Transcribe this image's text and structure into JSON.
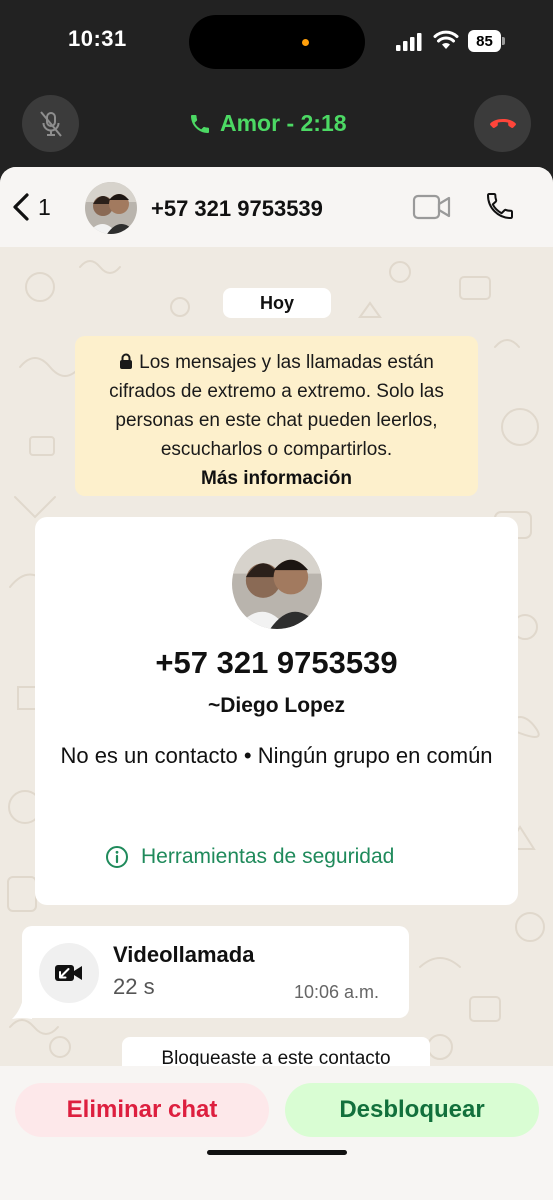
{
  "status_bar": {
    "time": "10:31",
    "battery": "85"
  },
  "call_bar": {
    "title": "Amor - 2:18"
  },
  "chat_header": {
    "back_count": "1",
    "name": "+57 321 9753539"
  },
  "chat": {
    "date_label": "Hoy",
    "encryption_notice": "Los mensajes y las llamadas están cifrados de extremo a extremo. Solo las personas en este chat pueden leerlos, escucharlos o compartirlos.",
    "encryption_more": "Más información"
  },
  "contact_card": {
    "phone": "+57 321 9753539",
    "name": "~Diego Lopez",
    "meta": "No es un contacto • Ningún grupo en común",
    "safety_tools": "Herramientas de seguridad"
  },
  "call_message": {
    "type": "Videollamada",
    "duration": "22 s",
    "time": "10:06 a.m."
  },
  "system_message": "Bloqueaste a este contacto",
  "actions": {
    "delete_label": "Eliminar chat",
    "unblock_label": "Desbloquear"
  },
  "colors": {
    "call_green": "#4cd964",
    "hangup_red": "#ff453a",
    "delete_red": "#dd1f3f",
    "unblock_green": "#12703c",
    "safety_green": "#1f8a5b"
  },
  "icons": [
    "mic-muted-icon",
    "phone-icon",
    "hang-up-icon",
    "back-chevron-icon",
    "video-camera-icon",
    "lock-icon",
    "info-icon",
    "incoming-video-call-icon"
  ]
}
